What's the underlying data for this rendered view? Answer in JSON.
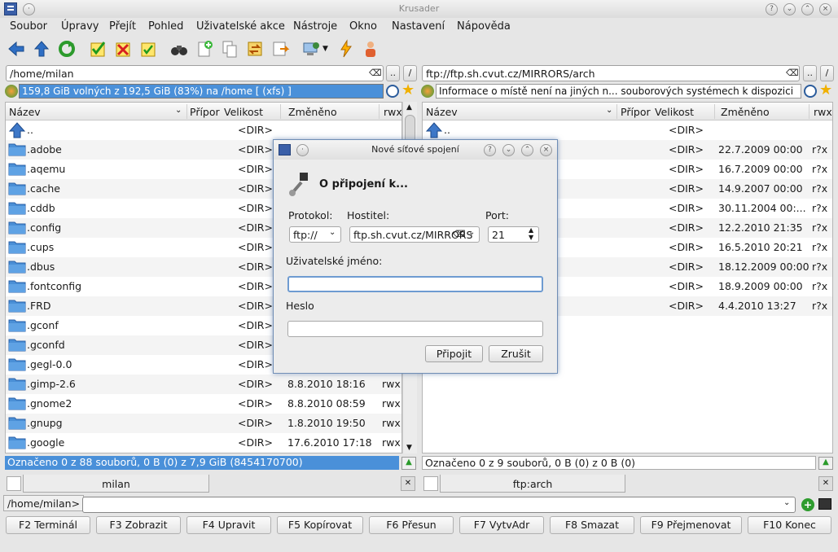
{
  "window": {
    "title": "Krusader"
  },
  "menu": [
    "Soubor",
    "Úpravy",
    "Přejít",
    "Pohled",
    "Uživatelské akce",
    "Nástroje",
    "Okno",
    "Nastavení",
    "Nápověda"
  ],
  "left": {
    "path": "/home/milan",
    "free": "159,8 GiB volných z 192,5 GiB (83%) na /home [ (xfs) ]",
    "columns": [
      "Název",
      "Přípor",
      "Velikost",
      "Změněno",
      "rwx"
    ],
    "rows": [
      {
        "name": "..",
        "size": "<DIR>",
        "date": "",
        "perm": ""
      },
      {
        "name": ".adobe",
        "size": "<DIR>",
        "date": "",
        "perm": ""
      },
      {
        "name": ".aqemu",
        "size": "<DIR>",
        "date": "",
        "perm": ""
      },
      {
        "name": ".cache",
        "size": "<DIR>",
        "date": "",
        "perm": ""
      },
      {
        "name": ".cddb",
        "size": "<DIR>",
        "date": "",
        "perm": ""
      },
      {
        "name": ".config",
        "size": "<DIR>",
        "date": "",
        "perm": ""
      },
      {
        "name": ".cups",
        "size": "<DIR>",
        "date": "",
        "perm": ""
      },
      {
        "name": ".dbus",
        "size": "<DIR>",
        "date": "",
        "perm": ""
      },
      {
        "name": ".fontconfig",
        "size": "<DIR>",
        "date": "",
        "perm": ""
      },
      {
        "name": ".FRD",
        "size": "<DIR>",
        "date": "",
        "perm": ""
      },
      {
        "name": ".gconf",
        "size": "<DIR>",
        "date": "",
        "perm": ""
      },
      {
        "name": ".gconfd",
        "size": "<DIR>",
        "date": "",
        "perm": ""
      },
      {
        "name": ".gegl-0.0",
        "size": "<DIR>",
        "date": "",
        "perm": ""
      },
      {
        "name": ".gimp-2.6",
        "size": "<DIR>",
        "date": "8.8.2010 18:16",
        "perm": "rwx"
      },
      {
        "name": ".gnome2",
        "size": "<DIR>",
        "date": "8.8.2010 08:59",
        "perm": "rwx"
      },
      {
        "name": ".gnupg",
        "size": "<DIR>",
        "date": "1.8.2010 19:50",
        "perm": "rwx"
      },
      {
        "name": ".google",
        "size": "<DIR>",
        "date": "17.6.2010 17:18",
        "perm": "rwx"
      }
    ],
    "status": "Označeno 0 z 88 souborů, 0 B  (0) z 7,9 GiB (8454170700)",
    "tab": "milan"
  },
  "right": {
    "path": "ftp://ftp.sh.cvut.cz/MIRRORS/arch",
    "free": "Informace o místě není na jiných n... souborových systémech k dispozici",
    "columns": [
      "Název",
      "Přípor",
      "Velikost",
      "Změněno",
      "rwx"
    ],
    "rows": [
      {
        "name": "..",
        "size": "<DIR>",
        "date": "",
        "perm": ""
      },
      {
        "name": "",
        "size": "<DIR>",
        "date": "22.7.2009 00:00",
        "perm": "r?x"
      },
      {
        "name": "",
        "size": "<DIR>",
        "date": "16.7.2009 00:00",
        "perm": "r?x"
      },
      {
        "name": "",
        "size": "<DIR>",
        "date": "14.9.2007 00:00",
        "perm": "r?x"
      },
      {
        "name": "",
        "size": "<DIR>",
        "date": "30.11.2004 00:...",
        "perm": "r?x"
      },
      {
        "name": "",
        "size": "<DIR>",
        "date": "12.2.2010 21:35",
        "perm": "r?x"
      },
      {
        "name": "",
        "size": "<DIR>",
        "date": "16.5.2010 20:21",
        "perm": "r?x"
      },
      {
        "name": "",
        "size": "<DIR>",
        "date": "18.12.2009 00:00",
        "perm": "r?x"
      },
      {
        "name": "",
        "size": "<DIR>",
        "date": "18.9.2009 00:00",
        "perm": "r?x"
      },
      {
        "name": "",
        "size": "<DIR>",
        "date": "4.4.2010 13:27",
        "perm": "r?x"
      }
    ],
    "status": "Označeno 0 z 9 souborů, 0 B  (0) z 0 B (0)",
    "tab": "ftp:arch"
  },
  "cmdline": {
    "prompt": "/home/milan>",
    "value": ""
  },
  "fkeys": [
    "F2 Terminál",
    "F3 Zobrazit",
    "F4 Upravit",
    "F5 Kopírovat",
    "F6 Přesun",
    "F7 VytvAdr",
    "F8 Smazat",
    "F9 Přejmenovat",
    "F10 Konec"
  ],
  "dialog": {
    "title": "Nové síťové spojení",
    "heading": "O připojení k...",
    "protocol_label": "Protokol:",
    "protocol_value": "ftp://",
    "host_label": "Hostitel:",
    "host_value": "ftp.sh.cvut.cz/MIRRORS",
    "port_label": "Port:",
    "port_value": "21",
    "user_label": "Uživatelské jméno:",
    "user_value": "",
    "pass_label": "Heslo",
    "pass_value": "",
    "connect": "Připojit",
    "cancel": "Zrušit"
  },
  "colors": {
    "selection": "#4a90d9",
    "accent_border": "#6f8db5"
  }
}
